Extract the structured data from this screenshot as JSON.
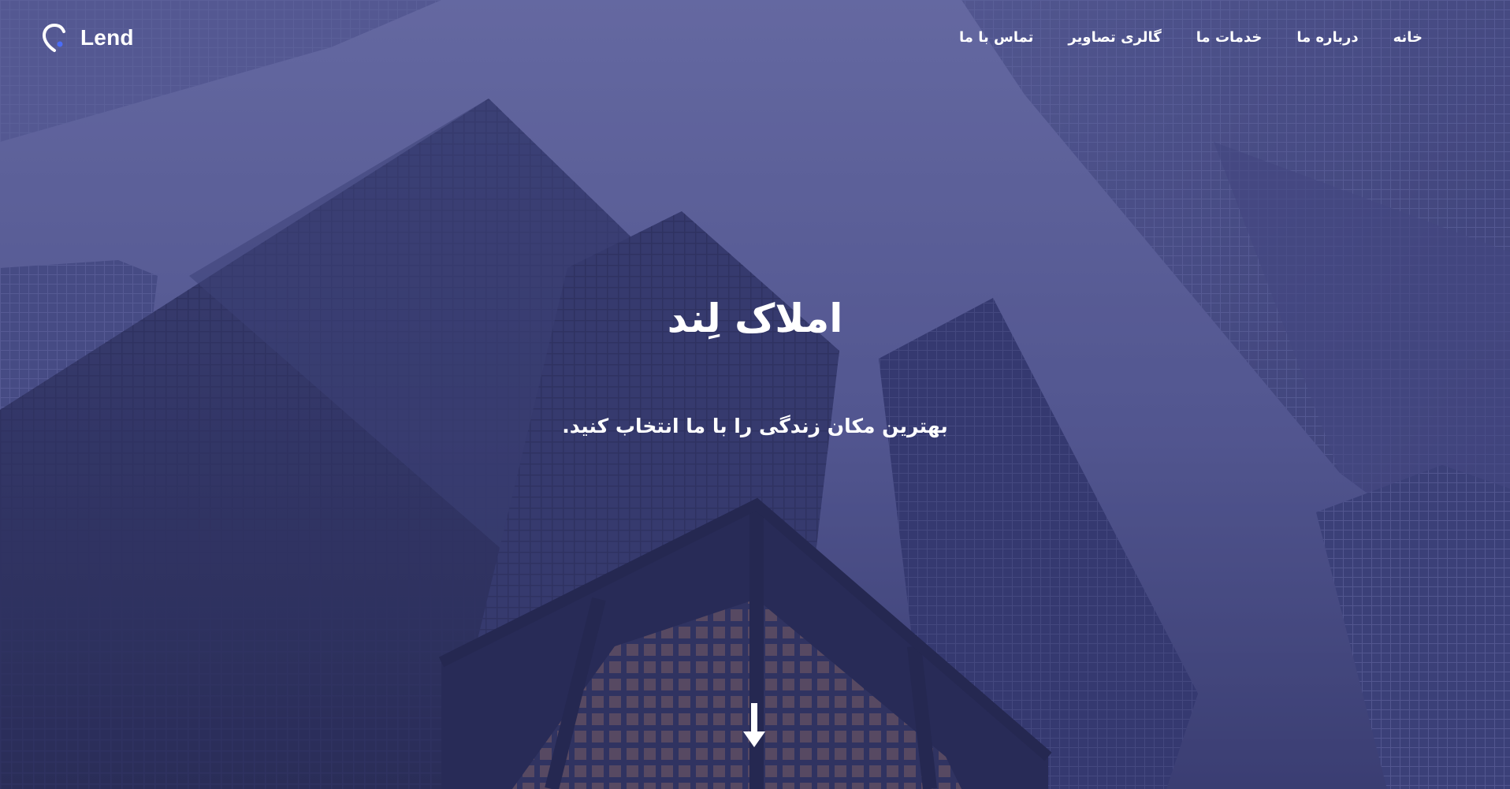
{
  "brand": {
    "name": "Lend",
    "accent": "#4a6cf7"
  },
  "nav": {
    "items": [
      {
        "label": "خانه"
      },
      {
        "label": "درباره ما"
      },
      {
        "label": "خدمات ما"
      },
      {
        "label": "گالری تصاویر"
      },
      {
        "label": "تماس با ما"
      }
    ]
  },
  "hero": {
    "title": "املاک لِند",
    "subtitle": "بهترین مکان زندگی را با ما انتخاب کنید.",
    "scroll_icon": "arrow-down-icon",
    "overlay_color": "#3c407a"
  }
}
